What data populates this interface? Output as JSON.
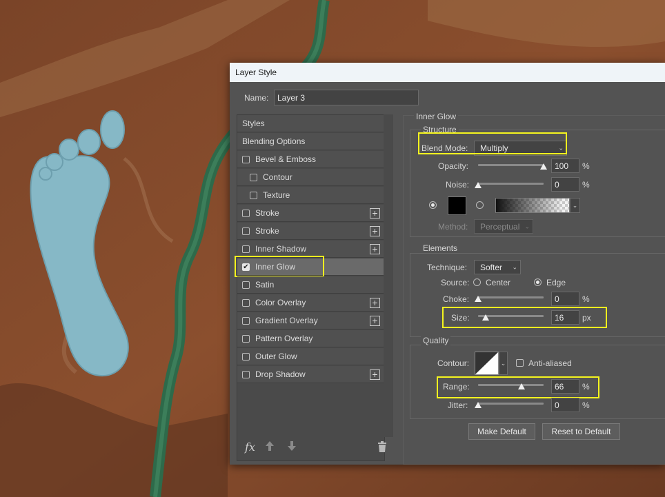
{
  "dialog": {
    "title": "Layer Style"
  },
  "name_field": {
    "label": "Name:",
    "value": "Layer 3"
  },
  "styles_list": [
    {
      "label": "Styles",
      "checkbox": false,
      "checked": false,
      "plus": false,
      "indent": false
    },
    {
      "label": "Blending Options",
      "checkbox": false,
      "checked": false,
      "plus": false,
      "indent": false
    },
    {
      "label": "Bevel & Emboss",
      "checkbox": true,
      "checked": false,
      "plus": false,
      "indent": false
    },
    {
      "label": "Contour",
      "checkbox": true,
      "checked": false,
      "plus": false,
      "indent": true
    },
    {
      "label": "Texture",
      "checkbox": true,
      "checked": false,
      "plus": false,
      "indent": true
    },
    {
      "label": "Stroke",
      "checkbox": true,
      "checked": false,
      "plus": true,
      "indent": false
    },
    {
      "label": "Stroke",
      "checkbox": true,
      "checked": false,
      "plus": true,
      "indent": false
    },
    {
      "label": "Inner Shadow",
      "checkbox": true,
      "checked": false,
      "plus": true,
      "indent": false
    },
    {
      "label": "Inner Glow",
      "checkbox": true,
      "checked": true,
      "plus": false,
      "indent": false,
      "selected": true
    },
    {
      "label": "Satin",
      "checkbox": true,
      "checked": false,
      "plus": false,
      "indent": false
    },
    {
      "label": "Color Overlay",
      "checkbox": true,
      "checked": false,
      "plus": true,
      "indent": false
    },
    {
      "label": "Gradient Overlay",
      "checkbox": true,
      "checked": false,
      "plus": true,
      "indent": false
    },
    {
      "label": "Pattern Overlay",
      "checkbox": true,
      "checked": false,
      "plus": false,
      "indent": false
    },
    {
      "label": "Outer Glow",
      "checkbox": true,
      "checked": false,
      "plus": false,
      "indent": false
    },
    {
      "label": "Drop Shadow",
      "checkbox": true,
      "checked": false,
      "plus": true,
      "indent": false
    }
  ],
  "list_footer": {
    "fx_label": "fx",
    "up_icon": "arrow-up-icon",
    "down_icon": "arrow-down-icon",
    "trash_icon": "trash-icon"
  },
  "inner_glow": {
    "heading": "Inner Glow",
    "structure": {
      "title": "Structure",
      "blend_mode_label": "Blend Mode:",
      "blend_mode_value": "Multiply",
      "opacity_label": "Opacity:",
      "opacity_value": "100",
      "opacity_unit": "%",
      "opacity_level": 1.0,
      "noise_label": "Noise:",
      "noise_value": "0",
      "noise_unit": "%",
      "noise_level": 0.0,
      "method_label": "Method:",
      "method_value": "Perceptual"
    },
    "elements": {
      "title": "Elements",
      "technique_label": "Technique:",
      "technique_value": "Softer",
      "source_label": "Source:",
      "source_center": "Center",
      "source_edge": "Edge",
      "choke_label": "Choke:",
      "choke_value": "0",
      "choke_unit": "%",
      "choke_level": 0.0,
      "size_label": "Size:",
      "size_value": "16",
      "size_unit": "px",
      "size_level": 0.12
    },
    "quality": {
      "title": "Quality",
      "contour_label": "Contour:",
      "anti_aliased_label": "Anti-aliased",
      "range_label": "Range:",
      "range_value": "66",
      "range_unit": "%",
      "range_level": 0.66,
      "jitter_label": "Jitter:",
      "jitter_value": "0",
      "jitter_unit": "%",
      "jitter_level": 0.0
    },
    "buttons": {
      "make_default": "Make Default",
      "reset_default": "Reset to Default"
    }
  },
  "colors": {
    "highlight": "#f5f51e",
    "glow_swatch": "#000000",
    "footprint": "#86b8c6",
    "river": "#2e6a4a"
  }
}
